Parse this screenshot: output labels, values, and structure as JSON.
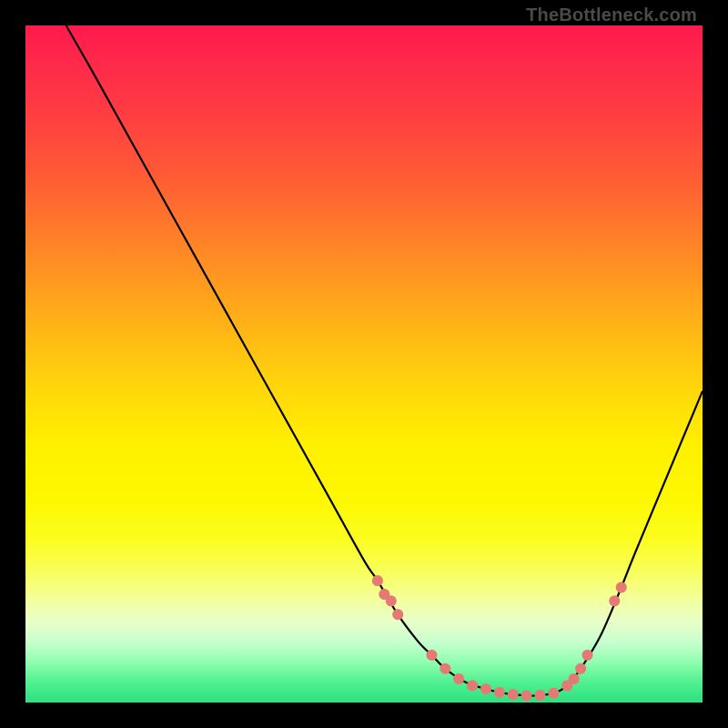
{
  "watermark": "TheBottleneck.com",
  "colors": {
    "background": "#000000",
    "curve": "#000000",
    "dot": "#e47a73",
    "gradient_top": "#ff1a4d",
    "gradient_bottom": "#2ee080"
  },
  "chart_data": {
    "type": "line",
    "title": "",
    "xlabel": "",
    "ylabel": "",
    "xlim": [
      0,
      100
    ],
    "ylim": [
      0,
      100
    ],
    "curve": {
      "name": "bottleneck-curve",
      "x": [
        6,
        10,
        15,
        20,
        25,
        30,
        35,
        40,
        45,
        50,
        52,
        55,
        58,
        60,
        62,
        65,
        68,
        70,
        72,
        75,
        78,
        80,
        82,
        85,
        88,
        90,
        95,
        100
      ],
      "y": [
        100,
        93,
        84,
        75,
        66,
        57,
        48,
        39,
        30,
        21,
        18,
        13,
        9,
        7,
        5,
        3,
        2,
        1.5,
        1.2,
        1,
        1.4,
        2.5,
        5,
        10,
        17,
        22,
        34,
        46
      ]
    },
    "points": {
      "name": "highlighted-points",
      "x": [
        52,
        53,
        54,
        55,
        60,
        62,
        64,
        66,
        68,
        70,
        72,
        74,
        76,
        78,
        80,
        81,
        82,
        83,
        87,
        88
      ],
      "y": [
        18,
        16,
        15,
        13,
        7,
        5,
        3.5,
        2.5,
        2,
        1.5,
        1.2,
        1,
        1.1,
        1.4,
        2.5,
        3.5,
        5,
        7,
        15,
        17
      ]
    }
  }
}
